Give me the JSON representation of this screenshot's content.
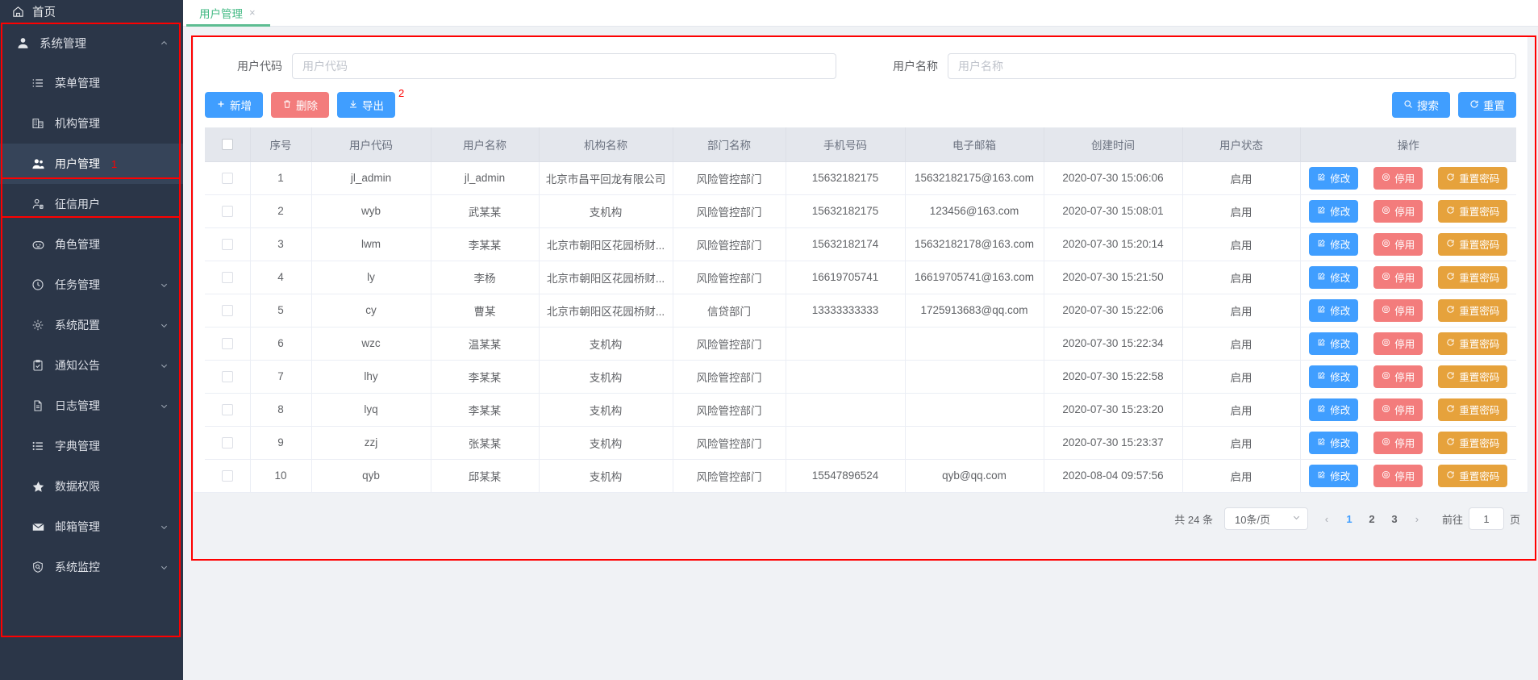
{
  "colors": {
    "sidebar_bg": "#2b3648",
    "sidebar_active": "#364459",
    "primary": "#409eff",
    "danger": "#f37c7c",
    "warning": "#e6a23c",
    "tab_accent": "#42b983",
    "annotation": "#ff0000"
  },
  "sidebar": {
    "home": {
      "label": "首页",
      "icon": "home-icon"
    },
    "items": [
      {
        "label": "系统管理",
        "icon": "user-solid-icon",
        "arrow": "chevron-up-icon",
        "level": 0,
        "active": false
      },
      {
        "label": "菜单管理",
        "icon": "list-icon",
        "arrow": "",
        "level": 1,
        "active": false
      },
      {
        "label": "机构管理",
        "icon": "building-icon",
        "arrow": "",
        "level": 1,
        "active": false
      },
      {
        "label": "用户管理",
        "icon": "users-icon",
        "arrow": "",
        "level": 1,
        "active": true,
        "annotation": "1"
      },
      {
        "label": "征信用户",
        "icon": "user-badge-icon",
        "arrow": "",
        "level": 1,
        "active": false
      },
      {
        "label": "角色管理",
        "icon": "robot-icon",
        "arrow": "",
        "level": 1,
        "active": false
      },
      {
        "label": "任务管理",
        "icon": "clock-icon",
        "arrow": "chevron-down-icon",
        "level": 1,
        "active": false
      },
      {
        "label": "系统配置",
        "icon": "gear-icon",
        "arrow": "chevron-down-icon",
        "level": 1,
        "active": false
      },
      {
        "label": "通知公告",
        "icon": "clipboard-check-icon",
        "arrow": "chevron-down-icon",
        "level": 1,
        "active": false
      },
      {
        "label": "日志管理",
        "icon": "document-icon",
        "arrow": "chevron-down-icon",
        "level": 1,
        "active": false
      },
      {
        "label": "字典管理",
        "icon": "list-bullet-icon",
        "arrow": "",
        "level": 1,
        "active": false
      },
      {
        "label": "数据权限",
        "icon": "star-icon",
        "arrow": "",
        "level": 1,
        "active": false
      },
      {
        "label": "邮箱管理",
        "icon": "mail-icon",
        "arrow": "chevron-down-icon",
        "level": 1,
        "active": false
      },
      {
        "label": "系统监控",
        "icon": "shield-search-icon",
        "arrow": "chevron-down-icon",
        "level": 1,
        "active": false
      }
    ]
  },
  "tabs": [
    {
      "label": "用户管理",
      "close": "×",
      "active": true
    }
  ],
  "search_form": {
    "user_code": {
      "label": "用户代码",
      "placeholder": "用户代码",
      "value": ""
    },
    "user_name": {
      "label": "用户名称",
      "placeholder": "用户名称",
      "value": ""
    }
  },
  "toolbar": {
    "add_label": "新增",
    "delete_label": "删除",
    "export_label": "导出",
    "search_label": "搜索",
    "reset_label": "重置",
    "annotation": "2"
  },
  "table": {
    "columns": [
      "",
      "序号",
      "用户代码",
      "用户名称",
      "机构名称",
      "部门名称",
      "手机号码",
      "电子邮箱",
      "创建时间",
      "用户状态",
      "操作"
    ],
    "row_actions": {
      "edit": "修改",
      "disable": "停用",
      "reset_password": "重置密码"
    },
    "rows": [
      {
        "index": "1",
        "code": "jl_admin",
        "name": "jl_admin",
        "org": "北京市昌平回龙有限公司",
        "dept": "风险管控部门",
        "phone": "15632182175",
        "email": "15632182175@163.com",
        "created": "2020-07-30 15:06:06",
        "status": "启用"
      },
      {
        "index": "2",
        "code": "wyb",
        "name": "武某某",
        "org": "支机构",
        "dept": "风险管控部门",
        "phone": "15632182175",
        "email": "123456@163.com",
        "created": "2020-07-30 15:08:01",
        "status": "启用"
      },
      {
        "index": "3",
        "code": "lwm",
        "name": "李某某",
        "org": "北京市朝阳区花园桥财...",
        "dept": "风险管控部门",
        "phone": "15632182174",
        "email": "15632182178@163.com",
        "created": "2020-07-30 15:20:14",
        "status": "启用"
      },
      {
        "index": "4",
        "code": "ly",
        "name": "李杨",
        "org": "北京市朝阳区花园桥财...",
        "dept": "风险管控部门",
        "phone": "16619705741",
        "email": "16619705741@163.com",
        "created": "2020-07-30 15:21:50",
        "status": "启用"
      },
      {
        "index": "5",
        "code": "cy",
        "name": "曹某",
        "org": "北京市朝阳区花园桥财...",
        "dept": "信贷部门",
        "phone": "13333333333",
        "email": "1725913683@qq.com",
        "created": "2020-07-30 15:22:06",
        "status": "启用"
      },
      {
        "index": "6",
        "code": "wzc",
        "name": "温某某",
        "org": "支机构",
        "dept": "风险管控部门",
        "phone": "",
        "email": "",
        "created": "2020-07-30 15:22:34",
        "status": "启用"
      },
      {
        "index": "7",
        "code": "lhy",
        "name": "李某某",
        "org": "支机构",
        "dept": "风险管控部门",
        "phone": "",
        "email": "",
        "created": "2020-07-30 15:22:58",
        "status": "启用"
      },
      {
        "index": "8",
        "code": "lyq",
        "name": "李某某",
        "org": "支机构",
        "dept": "风险管控部门",
        "phone": "",
        "email": "",
        "created": "2020-07-30 15:23:20",
        "status": "启用"
      },
      {
        "index": "9",
        "code": "zzj",
        "name": "张某某",
        "org": "支机构",
        "dept": "风险管控部门",
        "phone": "",
        "email": "",
        "created": "2020-07-30 15:23:37",
        "status": "启用"
      },
      {
        "index": "10",
        "code": "qyb",
        "name": "邱某某",
        "org": "支机构",
        "dept": "风险管控部门",
        "phone": "15547896524",
        "email": "qyb@qq.com",
        "created": "2020-08-04 09:57:56",
        "status": "启用"
      }
    ]
  },
  "pagination": {
    "total_text": "共 24 条",
    "page_size": "10条/页",
    "prev": "‹",
    "next": "›",
    "pages": [
      "1",
      "2",
      "3"
    ],
    "current_page": "1",
    "jump_prefix": "前往",
    "jump_value": "1",
    "jump_suffix": "页"
  }
}
